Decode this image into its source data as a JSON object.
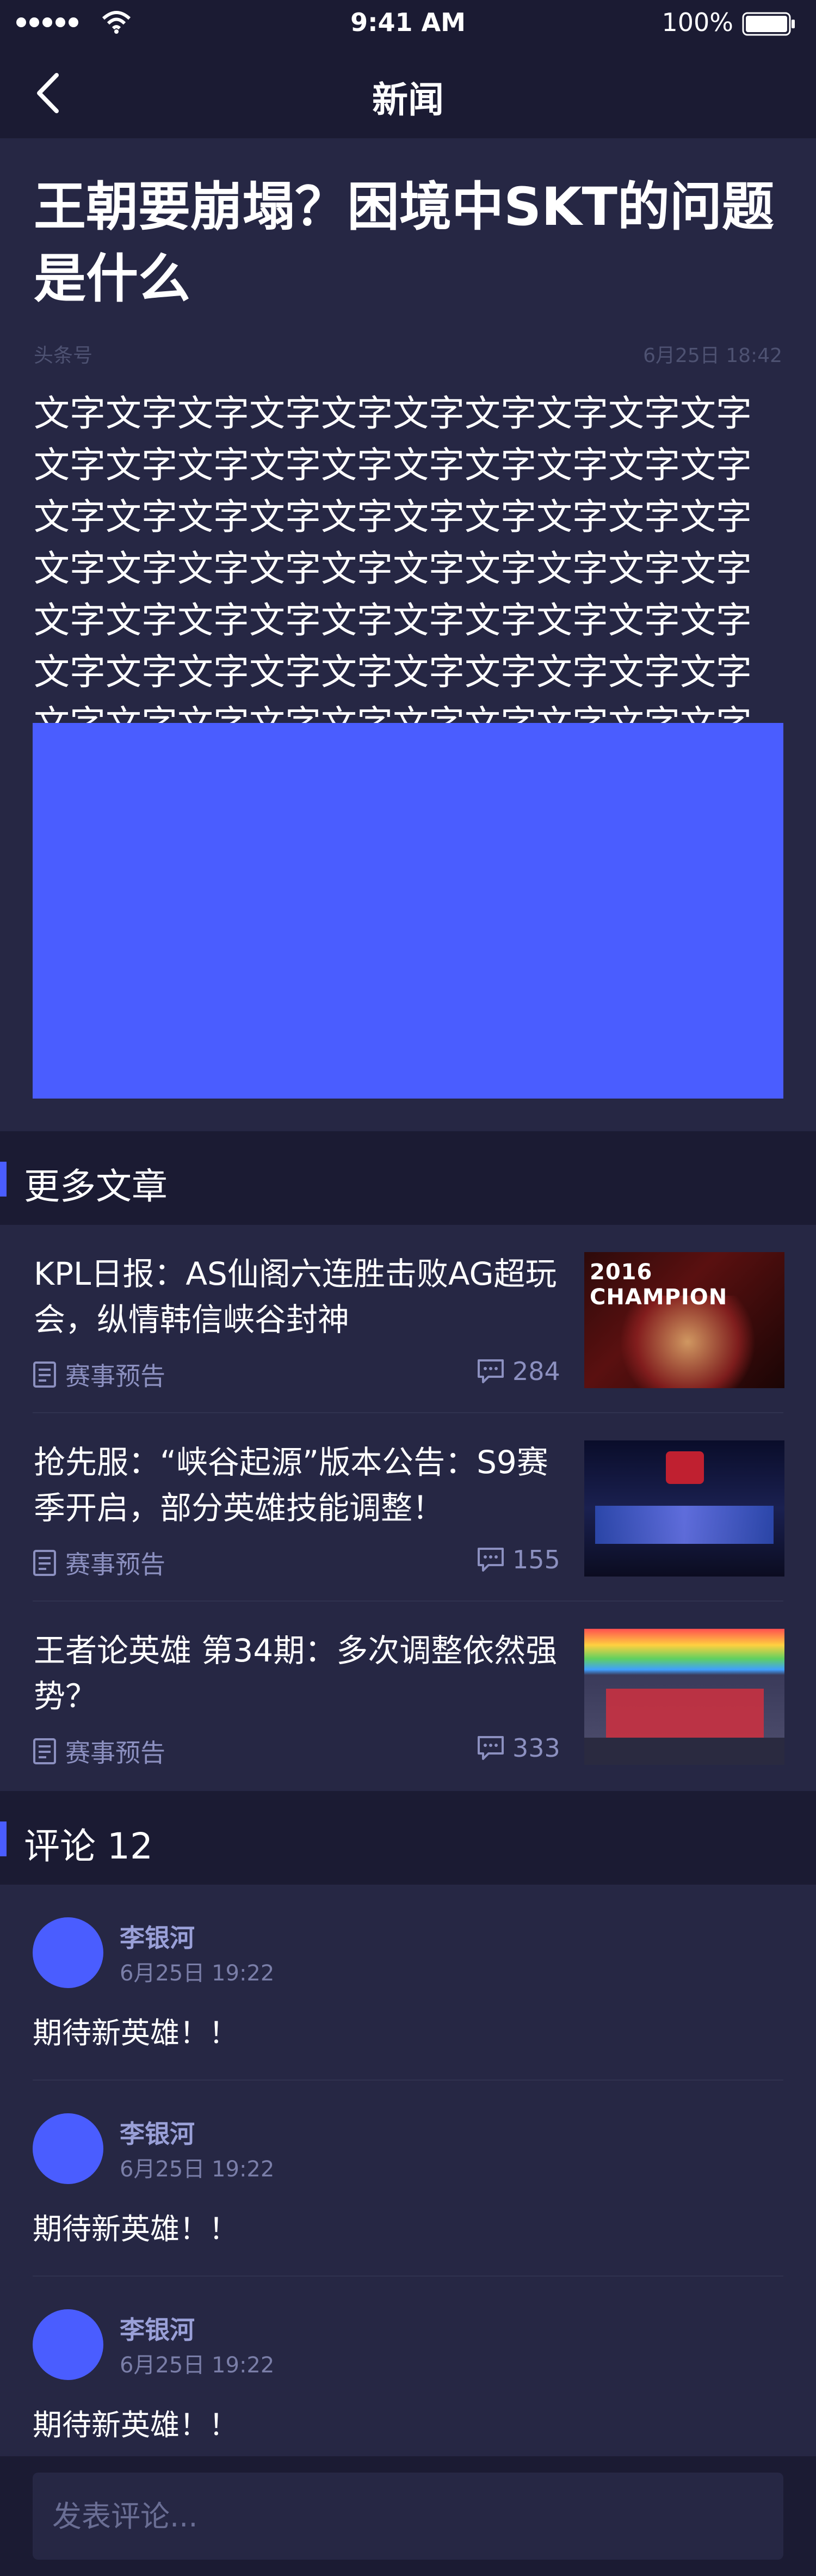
{
  "status_bar": {
    "time": "9:41 AM",
    "battery": "100%"
  },
  "nav": {
    "title": "新闻"
  },
  "article": {
    "headline": "王朝要崩塌？困境中SKT的问题是什么",
    "source": "头条号",
    "date": "6月25日 18:42",
    "body": "文字文字文字文字文字文字文字文字文字文字文字文字文字文字文字文字文字文字文字文字文字文字文字文字文字文字文字文字文字文字文字文字文字文字文字文字文字文字文字文字文字文字文字文字文字文字文字文字文字文字文字文字文字文字文字文字文字文字文字文字文字文字文字文字文字文字文字文字文字文字文字文字"
  },
  "more_articles": {
    "title": "更多文章",
    "items": [
      {
        "title": "KPL日报：AS仙阁六连胜击败AG超玩会，纵情韩信峡谷封神",
        "category": "赛事预告",
        "comments": "284",
        "thumb_text": "2016 CHAMPION"
      },
      {
        "title": "抢先服：“峡谷起源”版本公告：S9赛季开启，部分英雄技能调整！",
        "category": "赛事预告",
        "comments": "155"
      },
      {
        "title": "王者论英雄 第34期：多次调整依然强势？",
        "category": "赛事预告",
        "comments": "333"
      }
    ]
  },
  "comments": {
    "title": "评论 12",
    "items": [
      {
        "name": "李银河",
        "time": "6月25日 19:22",
        "text": "期待新英雄！！"
      },
      {
        "name": "李银河",
        "time": "6月25日 19:22",
        "text": "期待新英雄！！"
      },
      {
        "name": "李银河",
        "time": "6月25日 19:22",
        "text": "期待新英雄！！"
      }
    ]
  },
  "comment_input": {
    "placeholder": "发表评论..."
  },
  "colors": {
    "background": "#1b1b33",
    "card": "#262744",
    "accent": "#4a5dff",
    "muted": "#8c90c0"
  },
  "icons": [
    "signal-icon",
    "wifi-icon",
    "battery-icon",
    "back-icon",
    "document-icon",
    "comment-icon"
  ]
}
